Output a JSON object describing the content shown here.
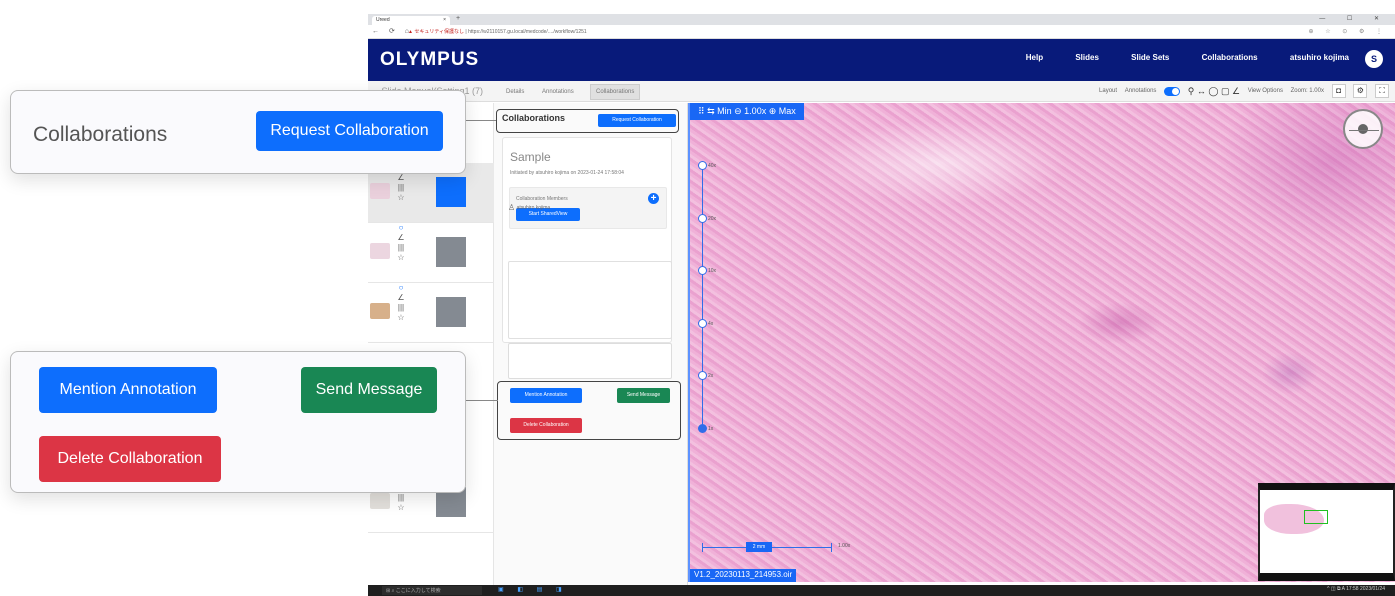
{
  "browser": {
    "tab_title": "Ureed",
    "tab_close": "×",
    "new_tab": "+",
    "window_controls": "— ☐ ✕",
    "nav_buttons": "← ⟳ ⌂",
    "url_warning": "▲ セキュリティ保護なし",
    "url": "https://w2110157.gu.local/medcode/..../workflow/1251",
    "ext_icons": "⊕ ☆ ⊙ ⚙ ⋮"
  },
  "app": {
    "logo": "OLYMPUS",
    "nav": [
      "Help",
      "Slides",
      "Slide Sets",
      "Collaborations"
    ],
    "user_name": "atsuhiro kojima",
    "avatar_letter": "S"
  },
  "subbar": {
    "back": "← Slide Manual(Setting1 (7)",
    "tabs": [
      "Details",
      "Annotations",
      "Collaborations"
    ],
    "layout": "Layout",
    "annotations_label": "Annotations",
    "tool_icons": "⚲ ↔ ◯ ▢ ∠",
    "view_options": "View Options",
    "zoom": "Zoom: 1.00x",
    "icon_buttons": [
      "◘",
      "⚙",
      "⛶"
    ]
  },
  "slides": [
    {
      "thumb_color": "#ead0dc",
      "swatch_color": "#0d6efd"
    },
    {
      "thumb_color": "#ecd6e0",
      "swatch_color": "#848a92"
    },
    {
      "thumb_color": "#d7b08a",
      "swatch_color": "#848a92"
    },
    {
      "thumb_color": "#e3e0dc",
      "swatch_color": "#848a92"
    }
  ],
  "slide_icons": {
    "circle": "○",
    "edit": "∠",
    "barcode": "|||",
    "star": "☆"
  },
  "collab": {
    "header": "Collaborations",
    "request_button": "Request Collaboration",
    "card_title": "Sample",
    "initiated": "Initiated by atsuhiro kojima on 2023-01-24 17:58:04",
    "members_label": "Collaboration Members",
    "add_icon": "+",
    "start_button": "Start SharedView",
    "member_icon": "♙",
    "member_name": "atsuhiro kojima",
    "mention_button": "Mention Annotation",
    "send_button": "Send Message",
    "delete_button": "Delete Collaboration"
  },
  "viewer": {
    "zoom_bar": "⠿ ⇆ Min ⊖ 1.00x ⊕ Max",
    "ticks": [
      "40x",
      "20x",
      "10x",
      "4x",
      "2x",
      "1x"
    ],
    "active_tick": "1x",
    "scale_label": "2 mm",
    "scale_zoom": "1.00x",
    "filename": "V1.2_20230113_214953.oir"
  },
  "taskbar": {
    "search": "⊞ ⌕ ここに入力して検索",
    "icons": "▣ ◧ ▤ ◨",
    "tray": "^ ◫ ⧉ A 17:58 2023/01/24"
  },
  "callout1": {
    "title": "Collaborations",
    "button": "Request Collaboration"
  },
  "callout2": {
    "mention": "Mention Annotation",
    "send": "Send Message",
    "delete": "Delete Collaboration"
  }
}
